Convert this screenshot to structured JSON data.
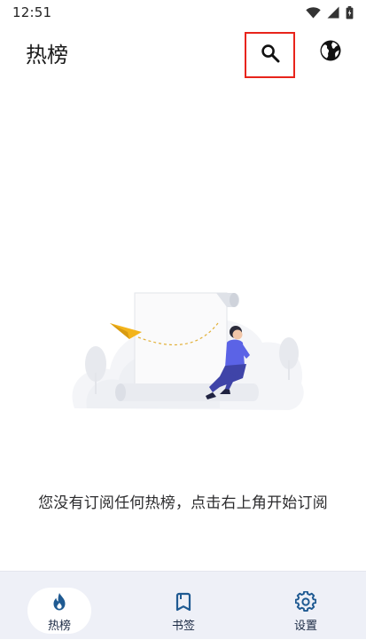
{
  "status_bar": {
    "time": "12:51",
    "icons": [
      "wifi-icon",
      "cellular-signal-icon",
      "battery-icon"
    ]
  },
  "header": {
    "title": "热榜",
    "actions": [
      "search-icon",
      "globe-icon"
    ],
    "highlight_color": "#e8241b"
  },
  "empty_state": {
    "message": "您没有订阅任何热榜，点击右上角开始订阅"
  },
  "bottom_nav": {
    "items": [
      {
        "label": "热榜",
        "icon": "flame-icon",
        "selected": true
      },
      {
        "label": "书签",
        "icon": "bookmark-icon",
        "selected": false
      },
      {
        "label": "设置",
        "icon": "gear-icon",
        "selected": false
      }
    ]
  },
  "colors": {
    "accent": "#1f5a92",
    "illustration_accent": "#5b63e6",
    "nav_background": "#eef0f7"
  }
}
